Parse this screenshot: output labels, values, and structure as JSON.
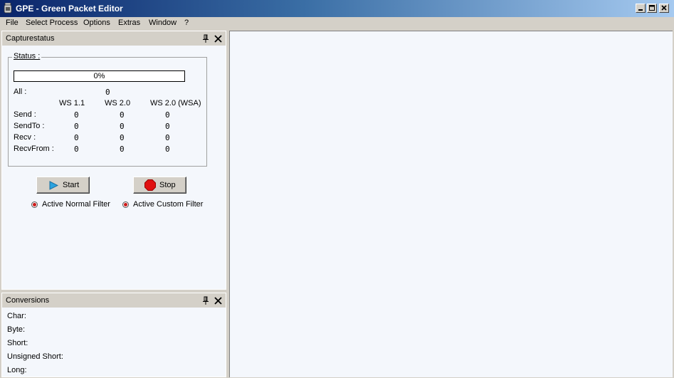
{
  "window": {
    "title": "GPE - Green Packet Editor",
    "icon": "app-icon"
  },
  "menu": {
    "items": [
      "File",
      "Select Process",
      "Options",
      "Extras",
      "Window",
      "?"
    ]
  },
  "capture_pane": {
    "title": "Capturestatus",
    "group_label": "Status :",
    "progress": {
      "percent_value": 0,
      "label": "0%"
    },
    "all_label": "All :",
    "all_value": "0",
    "columns": [
      "WS 1.1",
      "WS 2.0",
      "WS 2.0 (WSA)"
    ],
    "rows": [
      {
        "label": "Send :",
        "values": [
          "0",
          "0",
          "0"
        ]
      },
      {
        "label": "SendTo :",
        "values": [
          "0",
          "0",
          "0"
        ]
      },
      {
        "label": "Recv :",
        "values": [
          "0",
          "0",
          "0"
        ]
      },
      {
        "label": "RecvFrom :",
        "values": [
          "0",
          "0",
          "0"
        ]
      }
    ],
    "start_label": "Start",
    "stop_label": "Stop",
    "filter_normal": "Active Normal Filter",
    "filter_custom": "Active Custom Filter"
  },
  "conversions_pane": {
    "title": "Conversions",
    "items": [
      "Char:",
      "Byte:",
      "Short:",
      "Unsigned Short:",
      "Long:"
    ]
  },
  "colors": {
    "title_start": "#0a246a",
    "title_end": "#a6caf0",
    "pane_bg": "#f4f7fc",
    "chrome": "#d4d0c8",
    "start_icon": "#2aa3e0",
    "stop_icon": "#e01010"
  }
}
